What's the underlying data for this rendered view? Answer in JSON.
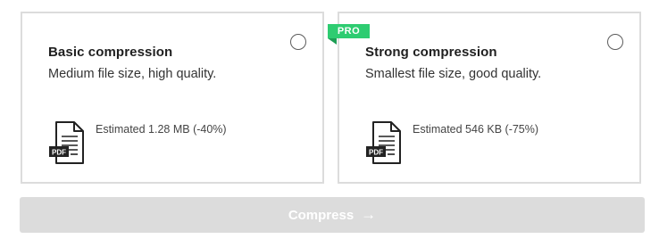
{
  "options": [
    {
      "title": "Basic compression",
      "description": "Medium file size, high quality.",
      "estimate": "Estimated 1.28 MB (-40%)",
      "selected": false,
      "file_badge": "PDF"
    },
    {
      "title": "Strong compression",
      "description": "Smallest file size, good quality.",
      "estimate": "Estimated 546 KB (-75%)",
      "selected": false,
      "file_badge": "PDF",
      "tier_badge": "PRO"
    }
  ],
  "action": {
    "label": "Compress",
    "icon": "arrow-right-icon",
    "disabled": true
  },
  "colors": {
    "pro_badge": "#2ecc71",
    "button_disabled": "#dcdcdc",
    "card_border": "#dcdcdc"
  }
}
